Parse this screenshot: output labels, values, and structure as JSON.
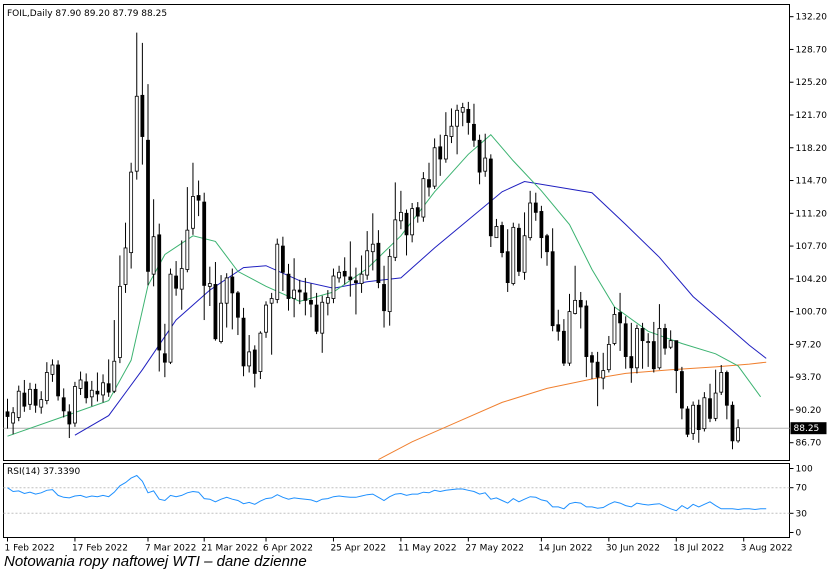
{
  "caption": "Notowania ropy naftowej WTI – dane dzienne",
  "chart_data": {
    "type": "candlestick",
    "symbol_header": "FOIL,Daily  87.90 89.20 87.79 88.25",
    "ylim": [
      84.8,
      133.5
    ],
    "y_ticks": [
      "132.20",
      "128.70",
      "125.20",
      "121.70",
      "118.20",
      "114.70",
      "111.20",
      "107.70",
      "104.20",
      "100.70",
      "97.20",
      "93.70",
      "90.20",
      "86.70"
    ],
    "y_tick_values": [
      132.2,
      128.7,
      125.2,
      121.7,
      118.2,
      114.7,
      111.2,
      107.7,
      104.2,
      100.7,
      97.2,
      93.7,
      90.2,
      86.7
    ],
    "last_price_label": "88.25",
    "last_price": 88.25,
    "x_tick_labels": [
      "1 Feb 2022",
      "17 Feb 2022",
      "7 Mar 2022",
      "21 Mar 2022",
      "6 Apr 2022",
      "25 Apr 2022",
      "11 May 2022",
      "27 May 2022",
      "14 Jun 2022",
      "30 Jun 2022",
      "18 Jul 2022",
      "3 Aug 2022"
    ],
    "x_tick_bar_index": [
      0,
      12,
      25,
      35,
      46,
      58,
      70,
      82,
      95,
      107,
      119,
      131
    ],
    "colors": {
      "bull": "#ffffff",
      "bear": "#000000",
      "wick": "#000000",
      "ma_fast": "#3cb371",
      "ma_slow": "#2020c0",
      "ma_long": "#f08030",
      "rsi": "#1e90ff"
    },
    "candles": [
      [
        90.0,
        89.5,
        91.4,
        88.2
      ],
      [
        88.8,
        89.9,
        90.5,
        87.6
      ],
      [
        89.4,
        92.2,
        92.8,
        89.0
      ],
      [
        92.0,
        90.6,
        93.4,
        90.0
      ],
      [
        90.8,
        92.4,
        93.1,
        90.2
      ],
      [
        92.4,
        90.7,
        93.0,
        89.9
      ],
      [
        90.5,
        91.3,
        92.2,
        89.8
      ],
      [
        91.2,
        94.2,
        95.3,
        90.8
      ],
      [
        94.0,
        95.0,
        95.6,
        93.2
      ],
      [
        95.0,
        91.7,
        95.5,
        91.2
      ],
      [
        91.5,
        90.1,
        92.5,
        89.4
      ],
      [
        90.0,
        88.7,
        90.8,
        87.2
      ],
      [
        88.8,
        92.7,
        93.2,
        88.4
      ],
      [
        92.5,
        93.4,
        94.3,
        91.8
      ],
      [
        93.2,
        91.5,
        94.1,
        90.9
      ],
      [
        91.6,
        92.3,
        93.3,
        90.6
      ],
      [
        92.2,
        91.9,
        94.2,
        91.1
      ],
      [
        91.8,
        93.1,
        94.0,
        91.0
      ],
      [
        93.0,
        92.1,
        95.6,
        91.6
      ],
      [
        92.2,
        95.4,
        99.8,
        92.0
      ],
      [
        95.8,
        103.4,
        106.7,
        95.2
      ],
      [
        103.6,
        107.5,
        110.2,
        102.7
      ],
      [
        107.0,
        115.6,
        116.6,
        105.3
      ],
      [
        115.7,
        123.7,
        130.5,
        114.8
      ],
      [
        123.8,
        119.4,
        129.4,
        116.4
      ],
      [
        119.0,
        105.0,
        125.0,
        103.5
      ],
      [
        104.7,
        108.7,
        112.7,
        103.4
      ],
      [
        108.9,
        96.6,
        110.1,
        94.3
      ],
      [
        96.2,
        95.3,
        99.4,
        93.7
      ],
      [
        95.3,
        104.7,
        105.3,
        95.1
      ],
      [
        104.5,
        103.2,
        106.1,
        102.4
      ],
      [
        103.1,
        105.3,
        108.3,
        100.9
      ],
      [
        105.2,
        109.4,
        114.0,
        104.9
      ],
      [
        109.6,
        113.0,
        116.6,
        108.9
      ],
      [
        113.1,
        112.6,
        114.7,
        110.9
      ],
      [
        112.4,
        103.5,
        113.4,
        99.8
      ],
      [
        103.4,
        103.7,
        105.5,
        101.3
      ],
      [
        103.6,
        97.8,
        106.0,
        97.6
      ],
      [
        97.5,
        101.6,
        104.6,
        97.3
      ],
      [
        101.6,
        104.3,
        104.8,
        99.0
      ],
      [
        104.4,
        102.7,
        105.3,
        98.8
      ],
      [
        102.7,
        100.1,
        102.9,
        98.2
      ],
      [
        100.0,
        94.9,
        101.1,
        93.8
      ],
      [
        94.9,
        96.4,
        98.2,
        94.2
      ],
      [
        96.6,
        94.1,
        97.1,
        92.6
      ],
      [
        94.3,
        98.4,
        98.6,
        93.5
      ],
      [
        98.5,
        101.4,
        101.8,
        97.9
      ],
      [
        101.6,
        102.1,
        102.7,
        96.1
      ],
      [
        102.0,
        107.9,
        108.5,
        101.6
      ],
      [
        107.7,
        104.9,
        108.7,
        102.9
      ],
      [
        104.7,
        102.1,
        105.8,
        100.8
      ],
      [
        102.1,
        103.0,
        106.4,
        100.1
      ],
      [
        103.0,
        102.8,
        104.1,
        101.5
      ],
      [
        102.7,
        101.9,
        104.3,
        100.3
      ],
      [
        101.9,
        101.5,
        103.7,
        100.1
      ],
      [
        101.4,
        98.6,
        102.7,
        98.3
      ],
      [
        98.4,
        101.7,
        102.4,
        96.3
      ],
      [
        101.6,
        102.2,
        103.0,
        100.3
      ],
      [
        102.1,
        104.5,
        105.3,
        101.6
      ],
      [
        104.3,
        104.9,
        105.6,
        103.8
      ],
      [
        105.0,
        104.5,
        106.5,
        103.6
      ],
      [
        104.4,
        104.1,
        108.2,
        102.3
      ],
      [
        104.0,
        103.8,
        105.4,
        100.4
      ],
      [
        103.7,
        104.7,
        106.7,
        102.7
      ],
      [
        104.6,
        107.2,
        109.3,
        104.1
      ],
      [
        107.1,
        107.9,
        111.2,
        105.1
      ],
      [
        108.0,
        103.8,
        109.4,
        103.2
      ],
      [
        103.6,
        100.8,
        105.6,
        99.0
      ],
      [
        100.7,
        106.6,
        107.4,
        99.2
      ],
      [
        106.5,
        110.5,
        114.5,
        106.1
      ],
      [
        110.4,
        111.3,
        113.6,
        109.5
      ],
      [
        111.2,
        108.9,
        111.6,
        106.7
      ],
      [
        108.9,
        111.7,
        112.3,
        108.1
      ],
      [
        111.8,
        110.9,
        112.4,
        110.2
      ],
      [
        110.8,
        114.9,
        115.6,
        110.3
      ],
      [
        114.8,
        114.0,
        116.6,
        113.0
      ],
      [
        114.1,
        118.2,
        119.2,
        113.8
      ],
      [
        118.3,
        117.0,
        119.6,
        115.2
      ],
      [
        117.0,
        119.5,
        122.0,
        116.6
      ],
      [
        119.4,
        120.5,
        122.4,
        118.7
      ],
      [
        120.5,
        122.2,
        122.8,
        117.5
      ],
      [
        122.0,
        122.5,
        123.0,
        120.5
      ],
      [
        122.3,
        120.9,
        123.1,
        119.6
      ],
      [
        120.7,
        119.0,
        122.9,
        118.3
      ],
      [
        119.0,
        115.6,
        119.6,
        114.3
      ],
      [
        115.7,
        117.1,
        119.7,
        115.1
      ],
      [
        117.0,
        108.8,
        117.5,
        107.6
      ],
      [
        108.6,
        109.8,
        110.6,
        108.6
      ],
      [
        109.9,
        107.0,
        110.3,
        106.5
      ],
      [
        107.1,
        103.8,
        109.5,
        102.8
      ],
      [
        103.7,
        109.7,
        110.2,
        103.5
      ],
      [
        109.6,
        105.0,
        110.1,
        104.5
      ],
      [
        104.9,
        108.8,
        111.3,
        104.1
      ],
      [
        108.6,
        112.3,
        113.6,
        108.3
      ],
      [
        112.3,
        111.3,
        113.4,
        110.4
      ],
      [
        111.4,
        108.6,
        112.0,
        106.4
      ],
      [
        108.8,
        107.1,
        109.0,
        105.6
      ],
      [
        107.1,
        99.2,
        109.6,
        98.6
      ],
      [
        99.3,
        98.6,
        100.9,
        97.6
      ],
      [
        98.6,
        95.2,
        99.9,
        94.9
      ],
      [
        95.2,
        100.7,
        102.6,
        94.9
      ],
      [
        100.5,
        101.9,
        105.6,
        100.4
      ],
      [
        101.9,
        101.2,
        102.8,
        98.9
      ],
      [
        101.3,
        95.9,
        101.9,
        93.7
      ],
      [
        96.0,
        95.3,
        96.4,
        93.5
      ],
      [
        95.3,
        93.7,
        96.4,
        90.6
      ],
      [
        93.6,
        94.4,
        96.3,
        92.4
      ],
      [
        94.5,
        97.2,
        98.1,
        94.2
      ],
      [
        97.3,
        100.4,
        101.2,
        97.1
      ],
      [
        100.6,
        99.5,
        102.7,
        96.5
      ],
      [
        99.4,
        95.9,
        100.2,
        94.6
      ],
      [
        95.9,
        94.7,
        99.5,
        93.1
      ],
      [
        94.7,
        98.9,
        99.3,
        94.1
      ],
      [
        98.9,
        97.6,
        99.5,
        94.6
      ],
      [
        97.5,
        97.5,
        98.4,
        94.8
      ],
      [
        97.5,
        94.6,
        99.6,
        94.2
      ],
      [
        94.7,
        98.9,
        101.5,
        94.5
      ],
      [
        98.9,
        96.8,
        99.4,
        96.1
      ],
      [
        96.9,
        97.6,
        98.7,
        96.7
      ],
      [
        97.6,
        94.4,
        97.6,
        92.0
      ],
      [
        94.3,
        90.4,
        94.8,
        89.2
      ],
      [
        90.3,
        87.6,
        90.6,
        87.3
      ],
      [
        87.7,
        90.7,
        91.1,
        87.0
      ],
      [
        90.7,
        88.1,
        91.3,
        86.7
      ],
      [
        88.2,
        91.5,
        92.1,
        87.9
      ],
      [
        91.4,
        89.3,
        93.0,
        88.9
      ],
      [
        89.3,
        92.0,
        94.5,
        89.0
      ],
      [
        92.1,
        94.2,
        95.0,
        91.8
      ],
      [
        94.2,
        90.7,
        94.4,
        89.2
      ],
      [
        90.7,
        86.9,
        91.1,
        86.0
      ],
      [
        86.9,
        88.3,
        89.2,
        86.7
      ]
    ],
    "ma_fast": [
      [
        0,
        87.4
      ],
      [
        10,
        89.5
      ],
      [
        18,
        91.2
      ],
      [
        22,
        95.5
      ],
      [
        25,
        103.5
      ],
      [
        28,
        106.8
      ],
      [
        33,
        108.8
      ],
      [
        37,
        108.2
      ],
      [
        41,
        105.0
      ],
      [
        46,
        103.4
      ],
      [
        52,
        101.8
      ],
      [
        58,
        102.8
      ],
      [
        64,
        105.3
      ],
      [
        70,
        108.8
      ],
      [
        76,
        113.5
      ],
      [
        82,
        117.5
      ],
      [
        86,
        119.6
      ],
      [
        90,
        116.8
      ],
      [
        95,
        113.6
      ],
      [
        100,
        110.0
      ],
      [
        104,
        105.2
      ],
      [
        108,
        101.2
      ],
      [
        114,
        98.6
      ],
      [
        120,
        97.3
      ],
      [
        126,
        96.2
      ],
      [
        130,
        94.9
      ],
      [
        134,
        91.6
      ]
    ],
    "ma_slow": [
      [
        12,
        87.5
      ],
      [
        18,
        89.6
      ],
      [
        24,
        94.5
      ],
      [
        30,
        99.8
      ],
      [
        36,
        103.0
      ],
      [
        42,
        105.4
      ],
      [
        46,
        105.6
      ],
      [
        52,
        104.0
      ],
      [
        58,
        103.2
      ],
      [
        64,
        103.9
      ],
      [
        70,
        104.3
      ],
      [
        76,
        107.5
      ],
      [
        82,
        110.5
      ],
      [
        88,
        113.5
      ],
      [
        92,
        114.6
      ],
      [
        98,
        114.0
      ],
      [
        104,
        113.4
      ],
      [
        110,
        110.0
      ],
      [
        116,
        106.5
      ],
      [
        122,
        102.3
      ],
      [
        128,
        99.2
      ],
      [
        132,
        97.1
      ],
      [
        135,
        95.7
      ]
    ],
    "ma_long": [
      [
        66,
        84.9
      ],
      [
        72,
        86.8
      ],
      [
        80,
        88.9
      ],
      [
        88,
        91.0
      ],
      [
        96,
        92.5
      ],
      [
        104,
        93.5
      ],
      [
        110,
        94.1
      ],
      [
        118,
        94.5
      ],
      [
        126,
        94.8
      ],
      [
        132,
        95.1
      ],
      [
        135,
        95.3
      ]
    ],
    "rsi": {
      "label": "RSI(14) 37.3390",
      "levels": [
        70,
        30
      ],
      "tick_labels": [
        "100",
        "70",
        "30",
        "0"
      ],
      "tick_values": [
        100,
        70,
        30,
        0
      ],
      "values": [
        70,
        64,
        65,
        61,
        63,
        60,
        62,
        66,
        67,
        58,
        55,
        54,
        57,
        58,
        55,
        57,
        56,
        58,
        56,
        63,
        73,
        78,
        85,
        89,
        80,
        62,
        65,
        52,
        50,
        58,
        56,
        58,
        62,
        64,
        63,
        53,
        52,
        48,
        52,
        55,
        52,
        50,
        45,
        47,
        44,
        49,
        53,
        54,
        59,
        55,
        52,
        54,
        53,
        52,
        51,
        48,
        52,
        53,
        56,
        57,
        56,
        55,
        55,
        57,
        59,
        60,
        55,
        50,
        56,
        60,
        61,
        58,
        60,
        60,
        63,
        62,
        66,
        64,
        66,
        67,
        68,
        68,
        66,
        64,
        60,
        62,
        52,
        54,
        50,
        46,
        53,
        48,
        52,
        56,
        55,
        51,
        49,
        40,
        40,
        37,
        45,
        47,
        46,
        40,
        40,
        38,
        39,
        44,
        48,
        46,
        42,
        40,
        46,
        44,
        43,
        44,
        45,
        41,
        37,
        34,
        42,
        37,
        44,
        40,
        44,
        48,
        42,
        37,
        37,
        37,
        36,
        37,
        37,
        36,
        37,
        37
      ]
    }
  }
}
